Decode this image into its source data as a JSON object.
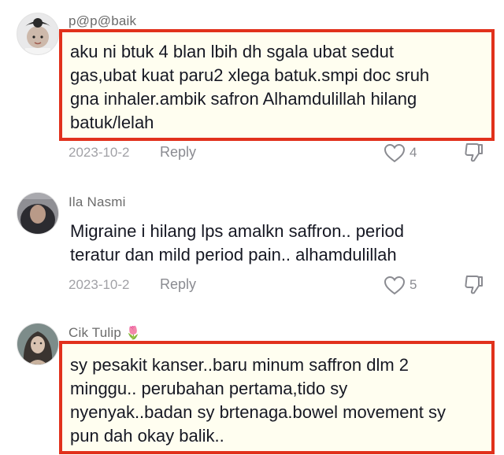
{
  "comments": [
    {
      "username": "p@p@baik",
      "avatar_icon": "child-photo-avatar",
      "text": "aku ni btuk 4 blan lbih dh sgala ubat sedut\ngas,ubat kuat paru2 xlega batuk.smpi doc sruh\ngna inhaler.ambik safron Alhamdulillah hilang\nbatuk/lelah",
      "date": "2023-10-2",
      "reply_label": "Reply",
      "likes": "4",
      "highlighted": true
    },
    {
      "username": "Ila Nasmi",
      "avatar_icon": "hijab-photo-avatar",
      "text": "Migraine i hilang lps amalkn saffron.. period\nteratur dan mild period pain.. alhamdulillah",
      "date": "2023-10-2",
      "reply_label": "Reply",
      "likes": "5",
      "highlighted": false
    },
    {
      "username": "Cik Tulip",
      "username_emoji": "🌷",
      "avatar_icon": "portrait-photo-avatar",
      "text": "sy pesakit kanser..baru minum saffron dlm 2\nminggu.. perubahan pertama,tido sy\nnyenyak..badan sy brtenaga.bowel movement sy\npun dah okay balik..",
      "highlighted": true
    }
  ],
  "colors": {
    "highlight_border": "#e1311c",
    "highlight_fill": "#fffef0",
    "text": "#161823",
    "muted": "#8a8b91"
  }
}
